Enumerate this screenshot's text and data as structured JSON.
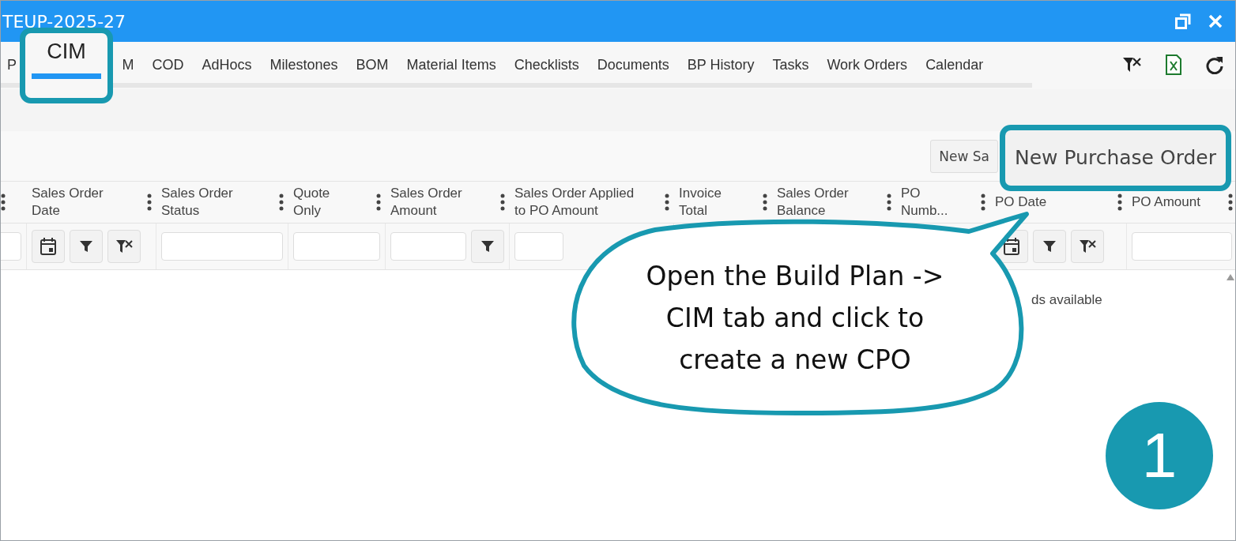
{
  "window": {
    "title": "TEUP-2025-27"
  },
  "tabs": [
    {
      "label": "P",
      "selected": false
    },
    {
      "label": "CIM",
      "selected": true
    },
    {
      "label": "M",
      "selected": false
    },
    {
      "label": "COD",
      "selected": false
    },
    {
      "label": "AdHocs",
      "selected": false
    },
    {
      "label": "Milestones",
      "selected": false
    },
    {
      "label": "BOM",
      "selected": false
    },
    {
      "label": "Material Items",
      "selected": false
    },
    {
      "label": "Checklists",
      "selected": false
    },
    {
      "label": "Documents",
      "selected": false
    },
    {
      "label": "BP History",
      "selected": false
    },
    {
      "label": "Tasks",
      "selected": false
    },
    {
      "label": "Work Orders",
      "selected": false
    },
    {
      "label": "Calendar",
      "selected": false
    }
  ],
  "toolbar": {
    "buttons": [
      {
        "label": "New Sa",
        "highlighted": false
      },
      {
        "label": "New Purchase Order",
        "highlighted": true
      }
    ]
  },
  "table": {
    "columns": [
      {
        "kind": "edge"
      },
      {
        "label": "Sales Order Date",
        "kind": "date"
      },
      {
        "label": "Sales Order Status",
        "kind": "text"
      },
      {
        "label": "Quote Only",
        "kind": "text"
      },
      {
        "label": "Sales Order Amount",
        "kind": "number"
      },
      {
        "label": "Sales Order Applied to PO Amount",
        "kind": "partial"
      },
      {
        "label": "Invoice Total",
        "kind": "hidden"
      },
      {
        "label": "Sales Order Balance",
        "kind": "hidden"
      },
      {
        "label": "PO Numb...",
        "kind": "hidden"
      },
      {
        "label": "PO Date",
        "kind": "date"
      },
      {
        "label": "PO Amount",
        "kind": "text"
      }
    ],
    "empty_message": "ds available"
  },
  "callout": {
    "text": "Open the Build Plan -> CIM tab and click to create a new CPO"
  },
  "step_badge": "1"
}
